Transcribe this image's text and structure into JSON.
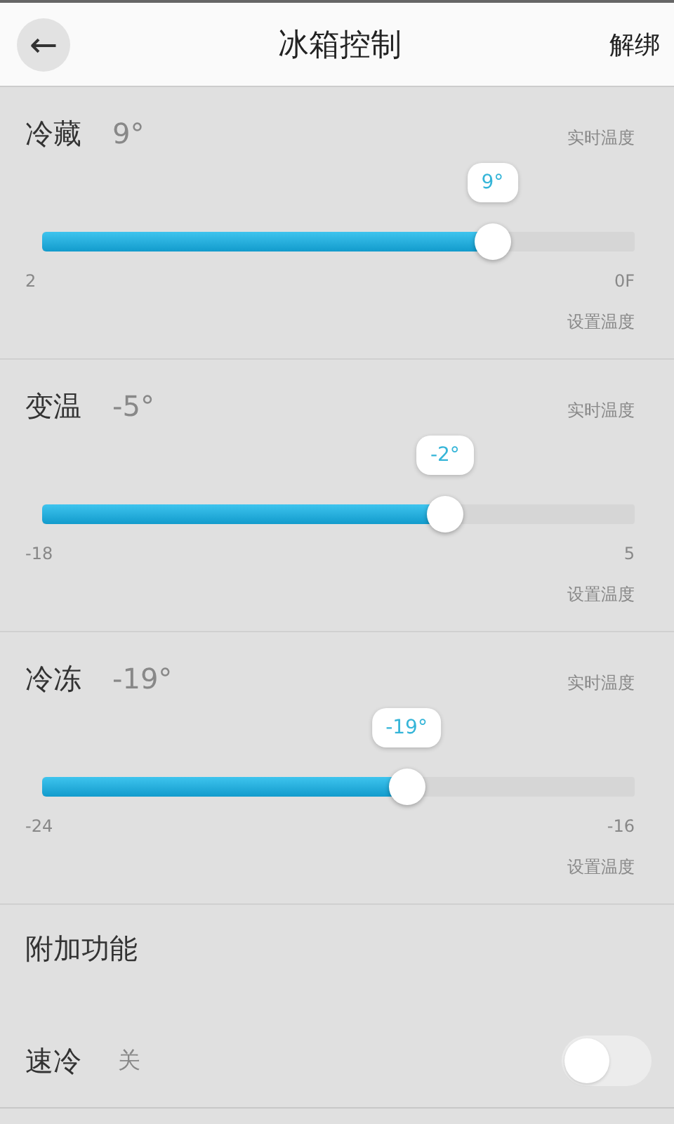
{
  "header": {
    "back": "←",
    "title": "冰箱控制",
    "action": "解绑"
  },
  "zones": [
    {
      "name": "冷藏",
      "current": "9°",
      "current_label": "实时温度",
      "bubble": "9°",
      "level": 0.76,
      "min": "2",
      "max": "0F",
      "set_label": "设置温度"
    },
    {
      "name": "变温",
      "current": "-5°",
      "current_label": "实时温度",
      "bubble": "-2°",
      "level": 0.68,
      "min": "-18",
      "max": "5",
      "set_label": "设置温度"
    },
    {
      "name": "冷冻",
      "current": "-19°",
      "current_label": "实时温度",
      "bubble": "-19°",
      "level": 0.615,
      "min": "-24",
      "max": "-16",
      "set_label": "设置温度"
    }
  ],
  "extras": {
    "title": "附加功能",
    "items": [
      {
        "label": "速冷",
        "state_text": "关",
        "on": false
      }
    ]
  }
}
